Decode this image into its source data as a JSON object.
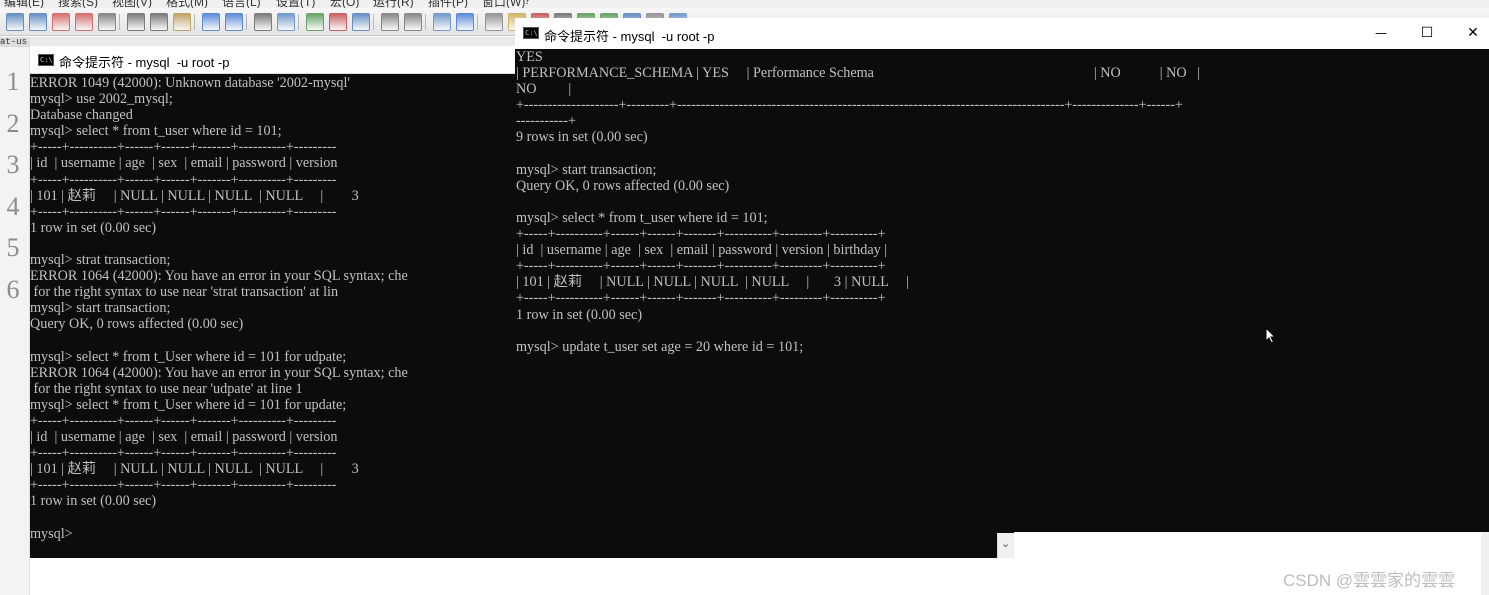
{
  "background_app": {
    "menu": [
      "编辑(E)",
      "搜索(S)",
      "视图(V)",
      "格式(M)",
      "语言(L)",
      "设置(T)",
      "宏(O)",
      "运行(R)",
      "插件(P)",
      "窗口(W)",
      "?"
    ],
    "tab_label": "at-us",
    "line_numbers": [
      "1",
      "2",
      "3",
      "4",
      "5",
      "6"
    ],
    "watermark": "CSDN @雲雲家的雲雲"
  },
  "left_console": {
    "title": "命令提示符 - mysql  -u root -p",
    "lines": [
      "ERROR 1049 (42000): Unknown database '2002-mysql'",
      "mysql> use 2002_mysql;",
      "Database changed",
      "mysql> select * from t_user where id = 101;",
      "+-----+----------+------+------+-------+----------+---------",
      "| id  | username | age  | sex  | email | password | version",
      "+-----+----------+------+------+-------+----------+---------",
      "| 101 | 赵莉     | NULL | NULL | NULL  | NULL     |        3",
      "+-----+----------+------+------+-------+----------+---------",
      "1 row in set (0.00 sec)",
      "",
      "mysql> strat transaction;",
      "ERROR 1064 (42000): You have an error in your SQL syntax; che",
      " for the right syntax to use near 'strat transaction' at lin",
      "mysql> start transaction;",
      "Query OK, 0 rows affected (0.00 sec)",
      "",
      "mysql> select * from t_User where id = 101 for udpate;",
      "ERROR 1064 (42000): You have an error in your SQL syntax; che",
      " for the right syntax to use near 'udpate' at line 1",
      "mysql> select * from t_User where id = 101 for update;",
      "+-----+----------+------+------+-------+----------+---------",
      "| id  | username | age  | sex  | email | password | version",
      "+-----+----------+------+------+-------+----------+---------",
      "| 101 | 赵莉     | NULL | NULL | NULL  | NULL     |        3",
      "+-----+----------+------+------+-------+----------+---------",
      "1 row in set (0.00 sec)",
      "",
      "mysql>"
    ]
  },
  "right_console": {
    "title": "命令提示符 - mysql  -u root -p",
    "controls": {
      "minimize": "—",
      "maximize": "☐",
      "close": "✕"
    },
    "lines": [
      "YES",
      "| PERFORMANCE_SCHEMA | YES     | Performance Schema                                                              | NO           | NO   |",
      "NO         |",
      "+--------------------+---------+----------------------------------------------------------------------------------+--------------+------+",
      "-----------+",
      "9 rows in set (0.00 sec)",
      "",
      "mysql> start transaction;",
      "Query OK, 0 rows affected (0.00 sec)",
      "",
      "mysql> select * from t_user where id = 101;",
      "+-----+----------+------+------+-------+----------+---------+----------+",
      "| id  | username | age  | sex  | email | password | version | birthday |",
      "+-----+----------+------+------+-------+----------+---------+----------+",
      "| 101 | 赵莉     | NULL | NULL | NULL  | NULL     |       3 | NULL     |",
      "+-----+----------+------+------+-------+----------+---------+----------+",
      "1 row in set (0.00 sec)",
      "",
      "mysql> update t_user set age = 20 where id = 101;"
    ]
  },
  "colors": {
    "console_bg": "#0c0c0c",
    "console_text": "#c0c0c0",
    "titlebar_bg": "#ffffff"
  }
}
